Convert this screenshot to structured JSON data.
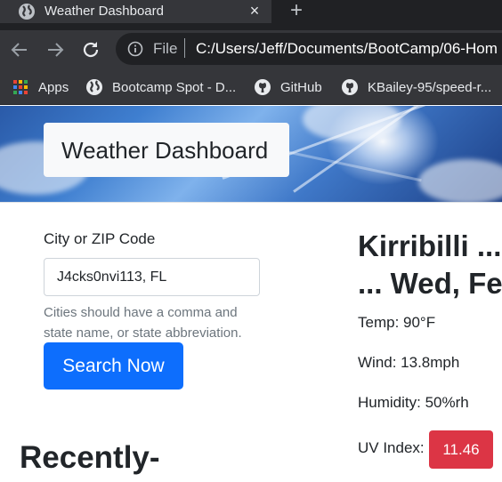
{
  "browser": {
    "tab_title": "Weather Dashboard",
    "tab_close": "×",
    "new_tab": "+",
    "omnibox_scheme": "File",
    "url": "C:/Users/Jeff/Documents/BootCamp/06-Hom",
    "bookmarks": [
      {
        "label": "Apps",
        "icon": "apps-grid-icon"
      },
      {
        "label": "Bootcamp Spot - D...",
        "icon": "globe-icon"
      },
      {
        "label": "GitHub",
        "icon": "github-icon"
      },
      {
        "label": "KBailey-95/speed-r...",
        "icon": "github-icon"
      }
    ]
  },
  "header": {
    "title": "Weather Dashboard"
  },
  "search": {
    "label": "City or ZIP Code",
    "value": "J4cks0nvi113, FL",
    "help": "Cities should have a comma and state name, or state abbreviation.",
    "button": "Search Now"
  },
  "recent": {
    "heading": "Recently-"
  },
  "current": {
    "city_line1": "Kirribilli ...",
    "city_line2": "... Wed, Fe",
    "temp": "Temp: 90°F",
    "wind": "Wind: 13.8mph",
    "humidity": "Humidity: 50%rh",
    "uv_label": "UV Index:",
    "uv_value": "11.46"
  },
  "colors": {
    "primary": "#0d6efd",
    "danger": "#dc3545",
    "chrome_dark": "#202124",
    "chrome": "#35363a"
  }
}
